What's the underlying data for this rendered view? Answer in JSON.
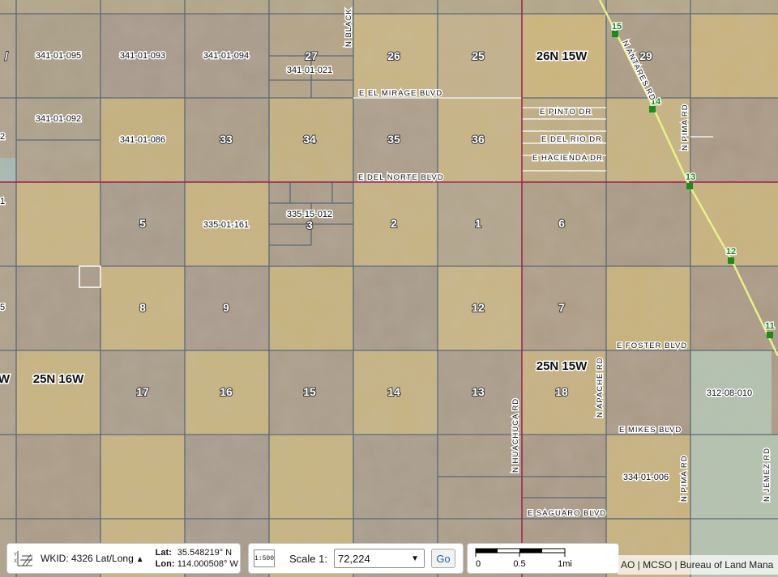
{
  "map": {
    "sections": [
      {
        "id": "s27",
        "label": "27"
      },
      {
        "id": "s26",
        "label": "26"
      },
      {
        "id": "s25",
        "label": "25"
      },
      {
        "id": "s29",
        "label": "29"
      },
      {
        "id": "s33",
        "label": "33"
      },
      {
        "id": "s34",
        "label": "34"
      },
      {
        "id": "s35",
        "label": "35"
      },
      {
        "id": "s36",
        "label": "36"
      },
      {
        "id": "s5",
        "label": "5"
      },
      {
        "id": "s3",
        "label": "3"
      },
      {
        "id": "s2",
        "label": "2"
      },
      {
        "id": "s1",
        "label": "1"
      },
      {
        "id": "s6",
        "label": "6"
      },
      {
        "id": "s8",
        "label": "8"
      },
      {
        "id": "s9",
        "label": "9"
      },
      {
        "id": "s12",
        "label": "12"
      },
      {
        "id": "s7",
        "label": "7"
      },
      {
        "id": "s17",
        "label": "17"
      },
      {
        "id": "s16",
        "label": "16"
      },
      {
        "id": "s15",
        "label": "15"
      },
      {
        "id": "s14",
        "label": "14"
      },
      {
        "id": "s13",
        "label": "13"
      },
      {
        "id": "s18",
        "label": "18"
      }
    ],
    "parcels": {
      "p095": "341-01-095",
      "p093": "341-01-093",
      "p094": "341-01-094",
      "p021": "341-01-021",
      "p092": "341-01-092",
      "p086": "341-01-086",
      "p161": "335-01-161",
      "p012": "335-15-012",
      "p010": "312-08-010",
      "p006": "334-01-006"
    },
    "townships": {
      "t1": "26N 15W",
      "t2": "25N 16W",
      "t3": "25N 15W"
    },
    "streets": {
      "black": "N BLACK",
      "el_mirage": "E EL MIRAGE BLVD",
      "pinto": "E PINTO DR",
      "del_rio": "E DEL RIO DR",
      "hacienda": "E HACIENDA DR",
      "del_norte": "E DEL NORTE BLVD",
      "antares": "N ANTARES RD",
      "pima_top": "N PIMA RD",
      "foster": "E FOSTER BLVD",
      "apache": "N APACHE RD",
      "huachuca": "N HUACHUCA RD",
      "mikes": "E MIKES BLVD",
      "pima_bottom": "N PIMA RD",
      "jemez": "N JEMEZ RD",
      "saguaro": "E SAGUARO BLVD"
    },
    "mileposts": [
      "15",
      "14",
      "13",
      "12",
      "11"
    ],
    "edge_labels": [
      "/",
      "2",
      "1",
      "5",
      "W"
    ]
  },
  "toolbar": {
    "wkid_text": "WKID: 4326 Lat/Long",
    "lat_label": "Lat:",
    "lat_value": "35.548219° N",
    "lon_label": "Lon:",
    "lon_value": "114.000508° W",
    "scale_label": "Scale 1:",
    "scale_value": "72,224",
    "go_label": "Go",
    "scalebar_ticks": [
      "0",
      "0.5",
      "1mi"
    ]
  },
  "attribution": "AO | MCSO | Bureau of Land Mana",
  "colors": {
    "section_line": "#5a6a78",
    "township_line": "#a01e4a",
    "highway": "#e8f08a",
    "milepost": "#1e8a1e"
  }
}
